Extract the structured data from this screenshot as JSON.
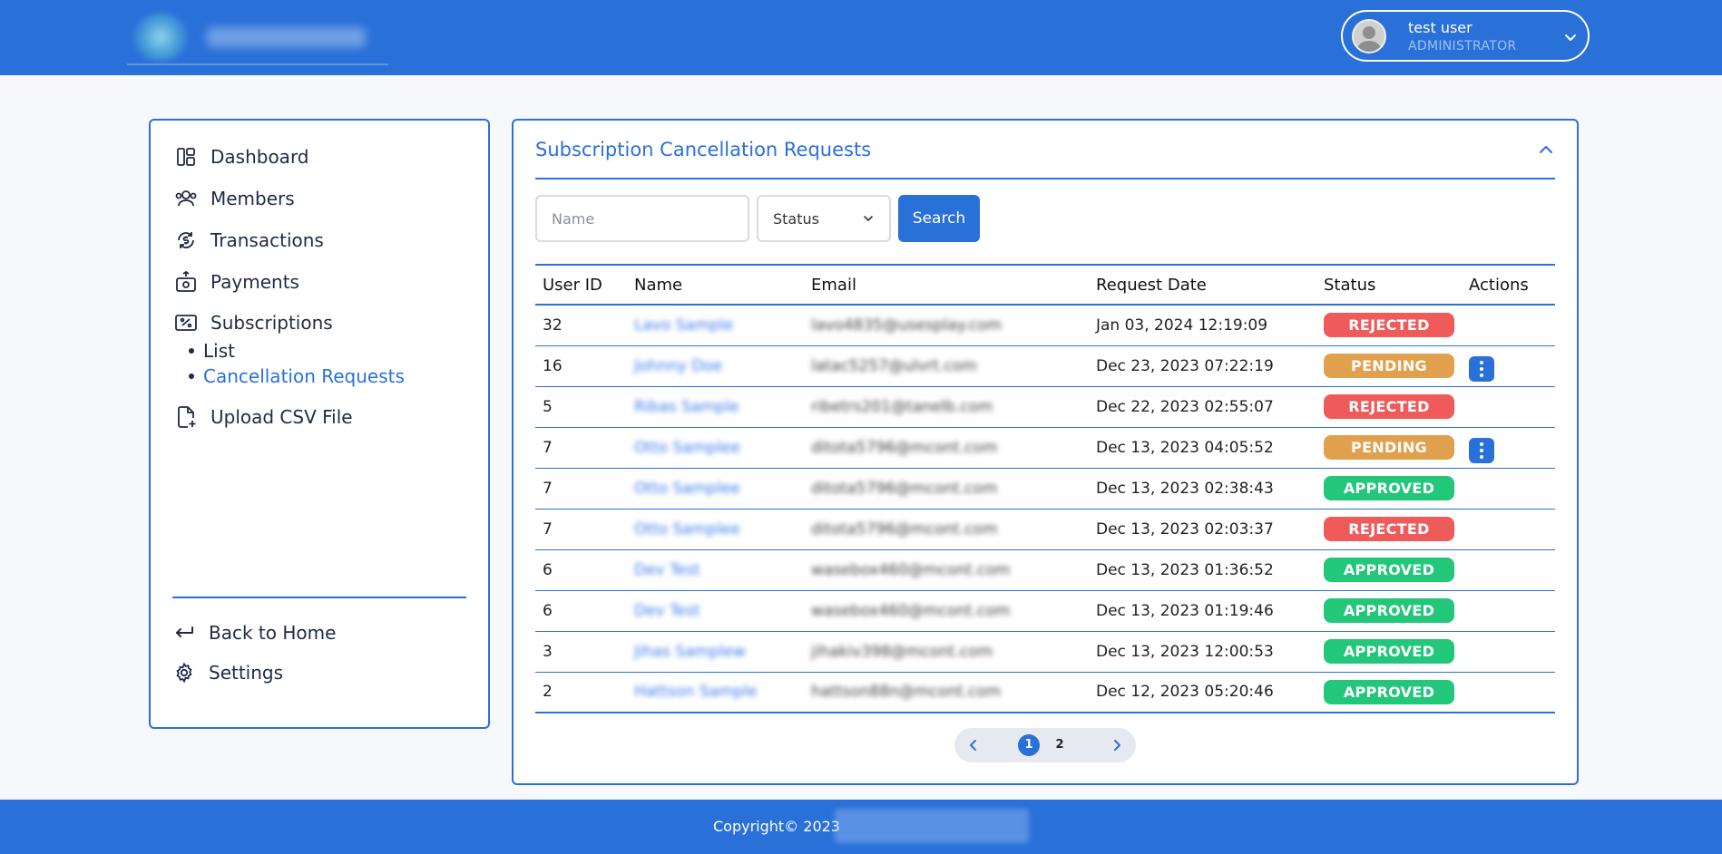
{
  "header": {
    "user_name": "test user",
    "user_role": "ADMINISTRATOR"
  },
  "sidebar": {
    "items": [
      {
        "label": "Dashboard",
        "icon": "dashboard-icon"
      },
      {
        "label": "Members",
        "icon": "members-icon"
      },
      {
        "label": "Transactions",
        "icon": "transactions-icon"
      },
      {
        "label": "Payments",
        "icon": "payments-icon"
      },
      {
        "label": "Subscriptions",
        "icon": "subscriptions-icon"
      },
      {
        "label": "Upload CSV File",
        "icon": "upload-file-icon"
      }
    ],
    "sub_items": [
      {
        "label": "List",
        "active": false
      },
      {
        "label": "Cancellation Requests",
        "active": true
      }
    ],
    "bottom_items": [
      {
        "label": "Back to Home",
        "icon": "back-arrow-icon"
      },
      {
        "label": "Settings",
        "icon": "gear-icon"
      }
    ]
  },
  "main": {
    "title": "Subscription Cancellation Requests",
    "filters": {
      "name_placeholder": "Name",
      "status_value": "Status",
      "search_label": "Search"
    },
    "table": {
      "columns": [
        "User ID",
        "Name",
        "Email",
        "Request Date",
        "Status",
        "Actions"
      ],
      "rows": [
        {
          "id": "32",
          "name": "Lavo Sample",
          "email": "lavo4835@usesplay.com",
          "date": "Jan 03, 2024 12:19:09",
          "status": "REJECTED",
          "has_action": false
        },
        {
          "id": "16",
          "name": "Johnny Doe",
          "email": "latac5257@ulvrt.com",
          "date": "Dec 23, 2023 07:22:19",
          "status": "PENDING",
          "has_action": true
        },
        {
          "id": "5",
          "name": "Ribas Sample",
          "email": "ribetrs201@tanelb.com",
          "date": "Dec 22, 2023 02:55:07",
          "status": "REJECTED",
          "has_action": false
        },
        {
          "id": "7",
          "name": "Otto Samplee",
          "email": "ditota5796@mcont.com",
          "date": "Dec 13, 2023 04:05:52",
          "status": "PENDING",
          "has_action": true
        },
        {
          "id": "7",
          "name": "Otto Samplee",
          "email": "ditota5796@mcont.com",
          "date": "Dec 13, 2023 02:38:43",
          "status": "APPROVED",
          "has_action": false
        },
        {
          "id": "7",
          "name": "Otto Samplee",
          "email": "ditota5796@mcont.com",
          "date": "Dec 13, 2023 02:03:37",
          "status": "REJECTED",
          "has_action": false
        },
        {
          "id": "6",
          "name": "Dev Test",
          "email": "wasebox460@mcont.com",
          "date": "Dec 13, 2023 01:36:52",
          "status": "APPROVED",
          "has_action": false
        },
        {
          "id": "6",
          "name": "Dev Test",
          "email": "wasebox460@mcont.com",
          "date": "Dec 13, 2023 01:19:46",
          "status": "APPROVED",
          "has_action": false
        },
        {
          "id": "3",
          "name": "Jihas Samplew",
          "email": "jihakiv398@mcont.com",
          "date": "Dec 13, 2023 12:00:53",
          "status": "APPROVED",
          "has_action": false
        },
        {
          "id": "2",
          "name": "Hattson Sample",
          "email": "hattson88n@mcont.com",
          "date": "Dec 12, 2023 05:20:46",
          "status": "APPROVED",
          "has_action": false
        }
      ]
    },
    "pagination": {
      "pages": [
        "1",
        "2"
      ],
      "current": "1"
    }
  },
  "footer": {
    "copyright": "Copyright© 2023"
  },
  "colors": {
    "primary": "#2a70d9",
    "rejected": "#ef5a5a",
    "pending": "#e0a04e",
    "approved": "#22c77a"
  }
}
